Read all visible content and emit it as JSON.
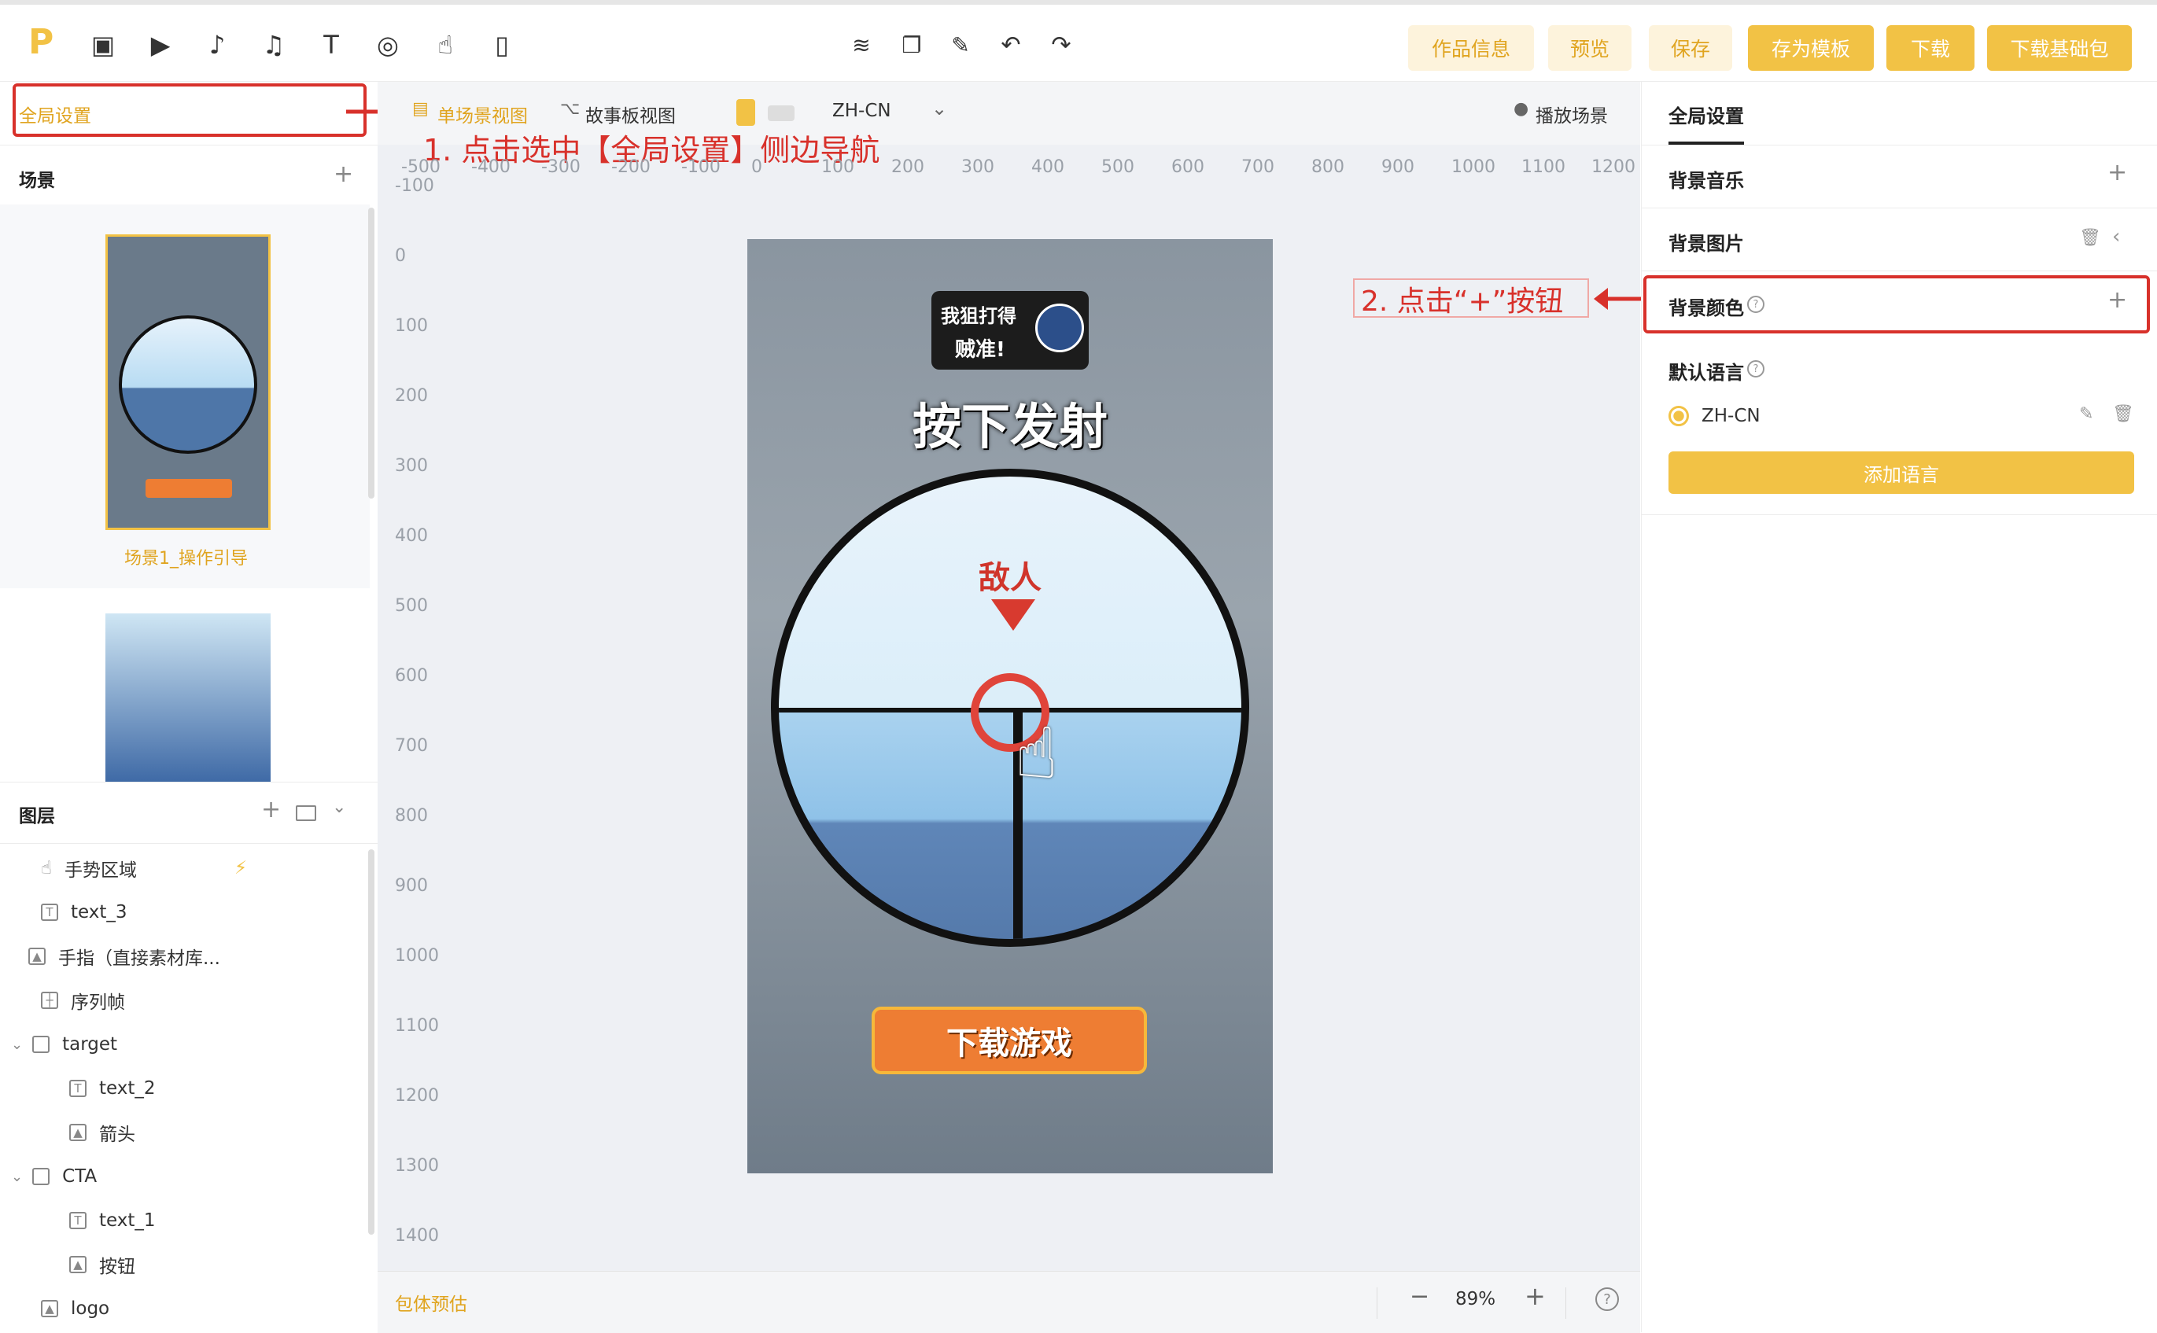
{
  "toolbar": {
    "logo": "P",
    "icons": [
      "image-icon",
      "video-icon",
      "music-note-icon",
      "music-icon",
      "text-icon",
      "target-icon",
      "gesture-icon",
      "phone-icon"
    ],
    "center_icons": [
      "layers-icon",
      "copy-icon",
      "paint-icon",
      "undo-icon",
      "redo-icon"
    ],
    "work_info": "作品信息",
    "preview": "预览",
    "save": "保存",
    "save_template": "存为模板",
    "download": "下载",
    "download_base": "下载基础包"
  },
  "left": {
    "global_settings": "全局设置",
    "scenes_title": "场景",
    "scene1_label": "场景1_操作引导",
    "layers_title": "图层",
    "layers": [
      {
        "label": "手势区域",
        "indent": 1,
        "icon": "gesture-icon"
      },
      {
        "label": "text_3",
        "indent": 1,
        "icon": "text-icon"
      },
      {
        "label": "手指（直接素材库...",
        "indent": 0,
        "icon": "image-icon"
      },
      {
        "label": "序列帧",
        "indent": 1,
        "icon": "frame-icon"
      },
      {
        "label": "target",
        "indent": 1,
        "icon": "folder-icon",
        "expanded": true
      },
      {
        "label": "text_2",
        "indent": 2,
        "icon": "text-icon"
      },
      {
        "label": "箭头",
        "indent": 2,
        "icon": "image-icon"
      },
      {
        "label": "CTA",
        "indent": 1,
        "icon": "folder-icon",
        "expanded": true
      },
      {
        "label": "text_1",
        "indent": 2,
        "icon": "text-icon"
      },
      {
        "label": "按钮",
        "indent": 2,
        "icon": "image-icon"
      },
      {
        "label": "logo",
        "indent": 1,
        "icon": "image-icon"
      }
    ]
  },
  "canvas": {
    "tab_single": "单场景视图",
    "tab_story": "故事板视图",
    "lang": "ZH-CN",
    "play_scene": "播放场景",
    "h_ruler": [
      "-500",
      "-400",
      "-300",
      "-200",
      "-100",
      "0",
      "100",
      "200",
      "300",
      "400",
      "500",
      "600",
      "700",
      "800",
      "900",
      "1000",
      "1100",
      "1200"
    ],
    "v_ruler": [
      "-100",
      "0",
      "100",
      "200",
      "300",
      "400",
      "500",
      "600",
      "700",
      "800",
      "900",
      "1000",
      "1100",
      "1200",
      "1300",
      "1400"
    ],
    "game_logo_line1": "我狙打得",
    "game_logo_line2": "贼准!",
    "headline": "按下发射",
    "enemy": "敌人",
    "cta": "下载游戏",
    "package_estimate": "包体预估",
    "zoom": "89%"
  },
  "annotations": {
    "step1": "1. 点击选中【全局设置】侧边导航",
    "step2": "2. 点击“+”按钮",
    "color": "#d8312b"
  },
  "right": {
    "tab": "全局设置",
    "bg_music": "背景音乐",
    "bg_image": "背景图片",
    "bg_color": "背景颜色",
    "default_lang": "默认语言",
    "lang_value": "ZH-CN",
    "add_lang": "添加语言"
  },
  "colors": {
    "accent": "#f2c245",
    "accent_text": "#e0a41f",
    "annotation": "#d8312b"
  }
}
